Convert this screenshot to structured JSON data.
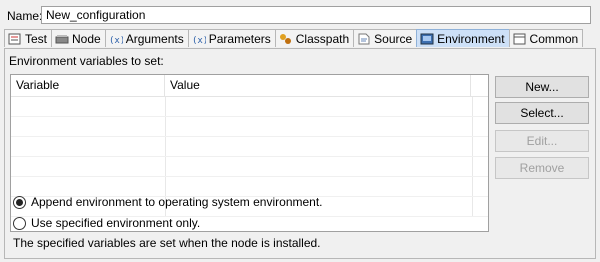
{
  "name": {
    "label": "Name:",
    "value": "New_configuration"
  },
  "tabs": [
    {
      "label": "Test",
      "icon": "test-icon"
    },
    {
      "label": "Node",
      "icon": "node-icon"
    },
    {
      "label": "Arguments",
      "icon": "arguments-icon"
    },
    {
      "label": "Parameters",
      "icon": "parameters-icon"
    },
    {
      "label": "Classpath",
      "icon": "classpath-icon"
    },
    {
      "label": "Source",
      "icon": "source-icon"
    },
    {
      "label": "Environment",
      "icon": "environment-icon",
      "active": true
    },
    {
      "label": "Common",
      "icon": "common-icon"
    }
  ],
  "environment": {
    "section_label": "Environment variables to set:",
    "columns": [
      "Variable",
      "Value"
    ],
    "buttons": {
      "new": "New...",
      "select": "Select...",
      "edit": "Edit...",
      "remove": "Remove"
    },
    "options": {
      "append": "Append environment to operating system environment.",
      "specified_only": "Use specified environment only."
    },
    "info": "The specified variables are set when the node is installed."
  },
  "colors": {
    "active_tab": "#cde0f7",
    "panel_bg": "#f0f0f0",
    "disabled_text": "#a0a0a0"
  }
}
